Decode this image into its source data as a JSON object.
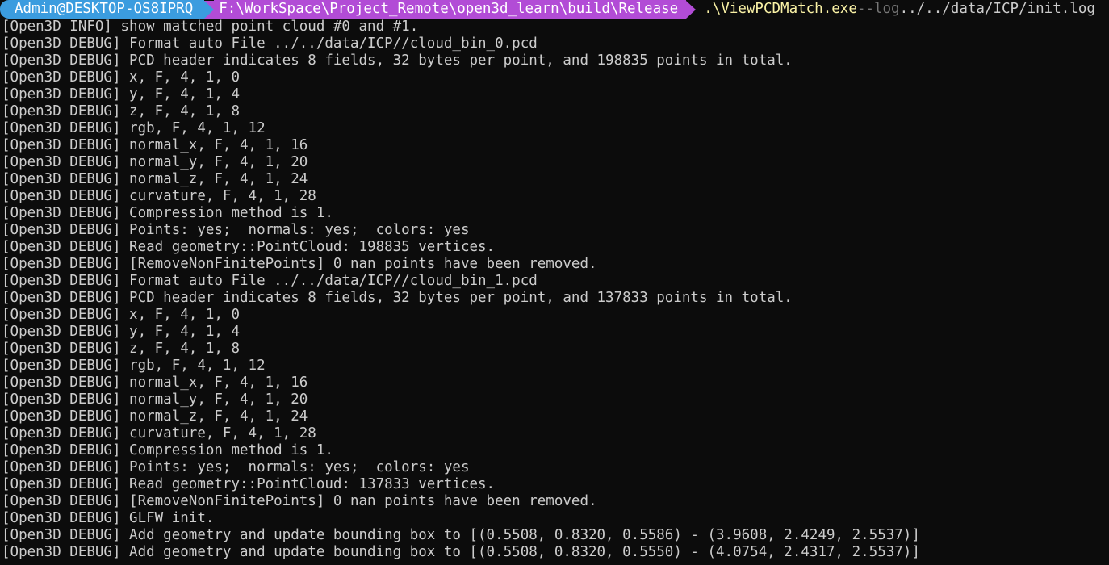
{
  "prompt": {
    "user": "Admin@DESKTOP-OS8IPRQ",
    "path": "F:\\WorkSpace\\Project_Remote\\open3d_learn\\build\\Release",
    "command": ".\\ViewPCDMatch.exe",
    "flag": "--log",
    "argument": "../../data/ICP/init.log"
  },
  "colors": {
    "background": "#0c0c0c",
    "text": "#cccccc",
    "user_segment": "#3b9cdf",
    "path_segment": "#b24cd6",
    "command": "#f9f1a5",
    "flag": "#767676"
  },
  "lines": [
    "[Open3D INFO] show matched point cloud #0 and #1.",
    "[Open3D DEBUG] Format auto File ../../data/ICP//cloud_bin_0.pcd",
    "[Open3D DEBUG] PCD header indicates 8 fields, 32 bytes per point, and 198835 points in total.",
    "[Open3D DEBUG] x, F, 4, 1, 0",
    "[Open3D DEBUG] y, F, 4, 1, 4",
    "[Open3D DEBUG] z, F, 4, 1, 8",
    "[Open3D DEBUG] rgb, F, 4, 1, 12",
    "[Open3D DEBUG] normal_x, F, 4, 1, 16",
    "[Open3D DEBUG] normal_y, F, 4, 1, 20",
    "[Open3D DEBUG] normal_z, F, 4, 1, 24",
    "[Open3D DEBUG] curvature, F, 4, 1, 28",
    "[Open3D DEBUG] Compression method is 1.",
    "[Open3D DEBUG] Points: yes;  normals: yes;  colors: yes",
    "[Open3D DEBUG] Read geometry::PointCloud: 198835 vertices.",
    "[Open3D DEBUG] [RemoveNonFinitePoints] 0 nan points have been removed.",
    "[Open3D DEBUG] Format auto File ../../data/ICP//cloud_bin_1.pcd",
    "[Open3D DEBUG] PCD header indicates 8 fields, 32 bytes per point, and 137833 points in total.",
    "[Open3D DEBUG] x, F, 4, 1, 0",
    "[Open3D DEBUG] y, F, 4, 1, 4",
    "[Open3D DEBUG] z, F, 4, 1, 8",
    "[Open3D DEBUG] rgb, F, 4, 1, 12",
    "[Open3D DEBUG] normal_x, F, 4, 1, 16",
    "[Open3D DEBUG] normal_y, F, 4, 1, 20",
    "[Open3D DEBUG] normal_z, F, 4, 1, 24",
    "[Open3D DEBUG] curvature, F, 4, 1, 28",
    "[Open3D DEBUG] Compression method is 1.",
    "[Open3D DEBUG] Points: yes;  normals: yes;  colors: yes",
    "[Open3D DEBUG] Read geometry::PointCloud: 137833 vertices.",
    "[Open3D DEBUG] [RemoveNonFinitePoints] 0 nan points have been removed.",
    "[Open3D DEBUG] GLFW init.",
    "[Open3D DEBUG] Add geometry and update bounding box to [(0.5508, 0.8320, 0.5586) - (3.9608, 2.4249, 2.5537)]",
    "[Open3D DEBUG] Add geometry and update bounding box to [(0.5508, 0.8320, 0.5550) - (4.0754, 2.4317, 2.5537)]"
  ]
}
